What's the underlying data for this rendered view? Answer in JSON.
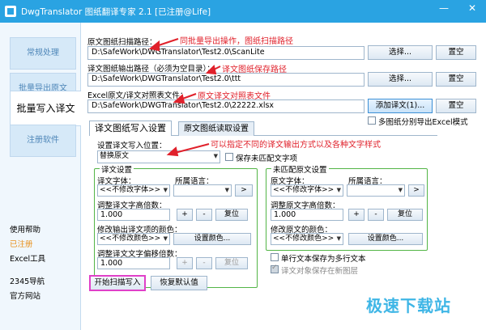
{
  "window": {
    "title": "DwgTranslator 图纸翻译专家 2.1 [已注册@Life]",
    "minimize": "—",
    "close": "✕"
  },
  "sidebar": {
    "tabs": [
      "常规处理",
      "批量导出原文",
      "批量写入译文",
      "注册软件"
    ],
    "links": [
      "使用帮助",
      "已注册",
      "Excel工具",
      "2345导航",
      "官方网站"
    ]
  },
  "paths": {
    "scan_label": "原文图纸扫描路径：",
    "scan_value": "D:\\SafeWork\\DWGTranslator\\Test2.0\\ScanLite",
    "output_label": "译文图纸输出路径（必须为空目录）：",
    "output_value": "D:\\SafeWork\\DWGTranslator\\Test2.0\\ttt",
    "excel_label": "Excel原文/译文对照表文件：",
    "excel_value": "D:\\SafeWork\\DWGTranslator\\Test2.0\\22222.xlsx",
    "browse": "选择...",
    "clear": "置空",
    "add_translation": "添加译文(1)...",
    "multi_excel": "多图纸分别导出Excel模式"
  },
  "annotations": {
    "a1": "同批量导出操作，图纸扫描路径",
    "a2": "译文图纸保存路径",
    "a3": "原文译文对照表文件",
    "a4": "可以指定不同的译文输出方式以及各种文字样式"
  },
  "tabs": [
    "译文图纸写入设置",
    "原文图纸读取设置"
  ],
  "write": {
    "position_label": "设置译文写入位置：",
    "position_value": "替换原文",
    "keep_unmatched": "保存未匹配文字项"
  },
  "translation_settings": {
    "legend": "译文设置",
    "font_label": "译文字体：",
    "lang_label": "所属语言：",
    "font_value": "<<不修改字体>>",
    "add": ">",
    "height_label": "调整译文字高倍数：",
    "height_value": "1.000",
    "plus": "+",
    "minus": "-",
    "reset": "复位",
    "color_label": "修改输出译文项的颜色：",
    "color_value": "<<不修改颜色>>",
    "set_color": "设置颜色...",
    "offset_label": "调整译文文字偏移倍数：",
    "offset_value": "1.000"
  },
  "unmatched_settings": {
    "legend": "未匹配原文设置",
    "font_label": "原文字体：",
    "lang_label": "所属语言：",
    "font_value": "<<不修改字体>>",
    "add": ">",
    "height_label": "调整原文字高倍数：",
    "height_value": "1.000",
    "plus": "+",
    "minus": "-",
    "reset": "复位",
    "color_label": "修改原文的颜色：",
    "color_value": "<<不修改颜色>>",
    "set_color": "设置颜色...",
    "single_to_multi": "单行文本保存为多行文本",
    "save_new_layer": "译文对象保存在新图层"
  },
  "actions": {
    "start": "开始扫描写入",
    "restore": "恢复默认值"
  },
  "watermark": "极速下载站"
}
